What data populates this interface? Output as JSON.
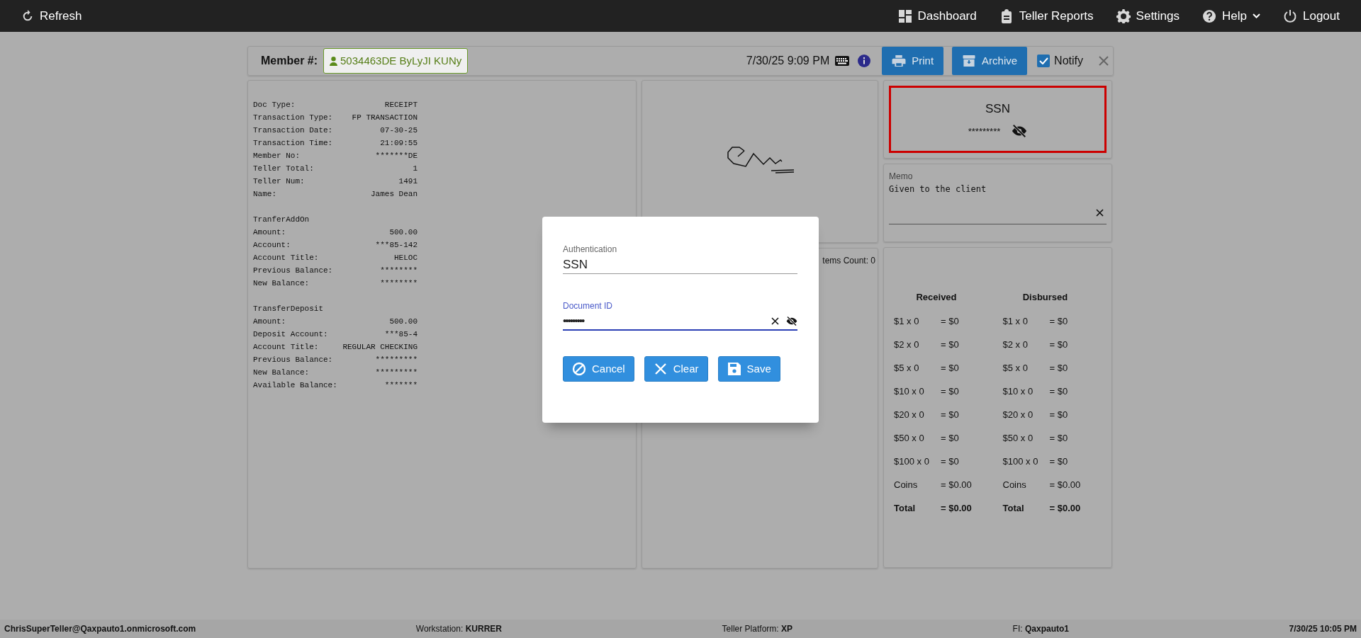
{
  "navbar": {
    "refresh": "Refresh",
    "items": [
      {
        "label": "Dashboard",
        "has_menu": false
      },
      {
        "label": "Teller Reports",
        "has_menu": false
      },
      {
        "label": "Settings",
        "has_menu": false
      },
      {
        "label": "Help",
        "has_menu": true
      },
      {
        "label": "Logout",
        "has_menu": false
      }
    ]
  },
  "header": {
    "member_label": "Member #:",
    "member_value": "5034463DE ByLyJI KUNy",
    "datetime": "7/30/25 9:09 PM",
    "buttons": [
      "Print",
      "Archive"
    ],
    "notify": {
      "label": "Notify",
      "checked": true
    }
  },
  "receipt": {
    "sections": [
      {
        "rows": [
          {
            "label": "Doc Type:",
            "value": "RECEIPT"
          },
          {
            "label": "Transaction Type:",
            "value": "FP TRANSACTION"
          },
          {
            "label": "Transaction Date:",
            "value": "07-30-25"
          },
          {
            "label": "Transaction Time:",
            "value": "21:09:55"
          },
          {
            "label": "Member No:",
            "value": "*******DE"
          },
          {
            "label": "Teller Total:",
            "value": "1"
          },
          {
            "label": "Teller Num:",
            "value": "1491"
          },
          {
            "label": "Name:",
            "value": "James Dean"
          }
        ]
      },
      {
        "title": "TranferAddOn",
        "rows": [
          {
            "label": "Amount:",
            "value": "500.00"
          },
          {
            "label": "Account:",
            "value": "***85-142"
          },
          {
            "label": "Account Title:",
            "value": "HELOC"
          },
          {
            "label": "Previous Balance:",
            "value": "********"
          },
          {
            "label": "New Balance:",
            "value": "********"
          }
        ]
      },
      {
        "title": "TransferDeposit",
        "rows": [
          {
            "label": "Amount:",
            "value": "500.00"
          },
          {
            "label": "Deposit Account:",
            "value": "***85-4"
          },
          {
            "label": "Account Title:",
            "value": "REGULAR CHECKING"
          },
          {
            "label": "Previous Balance:",
            "value": "*********"
          },
          {
            "label": "New Balance:",
            "value": "*********"
          },
          {
            "label": "Available Balance:",
            "value": "*******"
          }
        ]
      }
    ]
  },
  "items_count": "tems Count: 0",
  "ssn_card": {
    "title": "SSN",
    "value": "*********",
    "revealed": false
  },
  "memo": {
    "label": "Memo",
    "value": "Given to the client"
  },
  "cash": {
    "columns": [
      {
        "title": "Received",
        "rows": [
          {
            "label": "$1 x 0",
            "value": "= $0",
            "kind": "item"
          },
          {
            "label": "$2 x 0",
            "value": "= $0",
            "kind": "item"
          },
          {
            "label": "$5 x 0",
            "value": "= $0",
            "kind": "item"
          },
          {
            "label": "$10 x 0",
            "value": "= $0",
            "kind": "item"
          },
          {
            "label": "$20 x 0",
            "value": "= $0",
            "kind": "item"
          },
          {
            "label": "$50 x 0",
            "value": "= $0",
            "kind": "item"
          },
          {
            "label": "$100 x 0",
            "value": "= $0",
            "kind": "item"
          },
          {
            "label": "Coins",
            "value": "= $0.00",
            "kind": "item"
          },
          {
            "label": "Total",
            "value": "= $0.00",
            "kind": "total"
          }
        ]
      },
      {
        "title": "Disbursed",
        "rows": [
          {
            "label": "$1 x 0",
            "value": "= $0",
            "kind": "item"
          },
          {
            "label": "$2 x 0",
            "value": "= $0",
            "kind": "item"
          },
          {
            "label": "$5 x 0",
            "value": "= $0",
            "kind": "item"
          },
          {
            "label": "$10 x 0",
            "value": "= $0",
            "kind": "item"
          },
          {
            "label": "$20 x 0",
            "value": "= $0",
            "kind": "item"
          },
          {
            "label": "$50 x 0",
            "value": "= $0",
            "kind": "item"
          },
          {
            "label": "$100 x 0",
            "value": "= $0",
            "kind": "item"
          },
          {
            "label": "Coins",
            "value": "= $0.00",
            "kind": "item"
          },
          {
            "label": "Total",
            "value": "= $0.00",
            "kind": "total"
          }
        ]
      }
    ]
  },
  "modal": {
    "fields": [
      {
        "label": "Authentication",
        "value": "SSN",
        "focused": false,
        "masked": false
      },
      {
        "label": "Document ID",
        "value": "•••••••••",
        "focused": true,
        "masked": true
      }
    ],
    "buttons": [
      "Cancel",
      "Clear",
      "Save"
    ]
  },
  "footer": {
    "user": "ChrisSuperTeller@Qaxpauto1.onmicrosoft.com",
    "workstation": {
      "label": "Workstation:",
      "value": "KURRER"
    },
    "platform": {
      "label": "Teller Platform:",
      "value": "XP"
    },
    "fi": {
      "label": "FI:",
      "value": "Qaxpauto1"
    },
    "datetime": "7/30/25 10:05 PM"
  }
}
